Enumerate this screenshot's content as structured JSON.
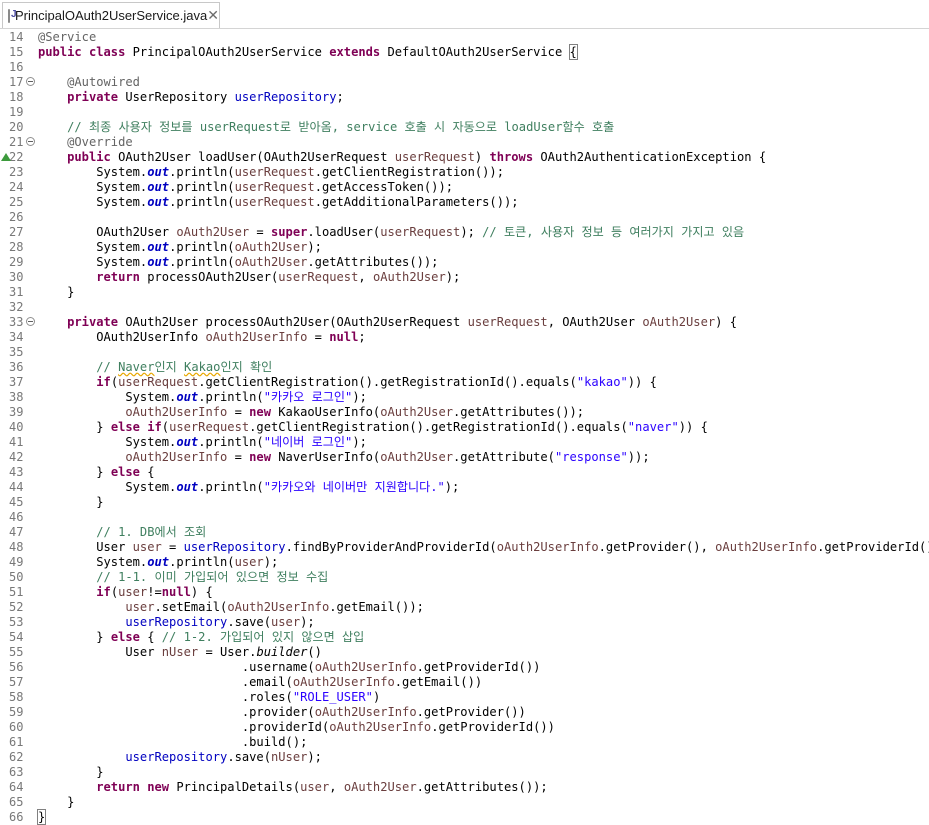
{
  "tab": {
    "filename": "PrincipalOAuth2UserService.java",
    "icon": "java-file-icon",
    "close_label": "✕"
  },
  "editor": {
    "lines": [
      {
        "n": "14",
        "segs": [
          [
            "an",
            "@Service"
          ]
        ]
      },
      {
        "n": "15",
        "segs": [
          [
            "kw",
            "public"
          ],
          [
            "p",
            " "
          ],
          [
            "kw",
            "class"
          ],
          [
            "p",
            " PrincipalOAuth2UserService "
          ],
          [
            "kw",
            "extends"
          ],
          [
            "p",
            " DefaultOAuth2UserService "
          ],
          [
            "brace",
            "{"
          ]
        ]
      },
      {
        "n": "16",
        "segs": []
      },
      {
        "n": "17",
        "fold": true,
        "segs": [
          [
            "p",
            "    "
          ],
          [
            "an",
            "@Autowired"
          ]
        ]
      },
      {
        "n": "18",
        "segs": [
          [
            "p",
            "    "
          ],
          [
            "kw",
            "private"
          ],
          [
            "p",
            " UserRepository "
          ],
          [
            "fd",
            "userRepository"
          ],
          [
            "p",
            ";"
          ]
        ]
      },
      {
        "n": "19",
        "segs": []
      },
      {
        "n": "20",
        "segs": [
          [
            "p",
            "    "
          ],
          [
            "cm",
            "// 최종 사용자 정보를 userRequest로 받아옴, service 호출 시 자동으로 loadUser함수 호출"
          ]
        ]
      },
      {
        "n": "21",
        "fold": true,
        "segs": [
          [
            "p",
            "    "
          ],
          [
            "an",
            "@Override"
          ]
        ]
      },
      {
        "n": "22",
        "override": true,
        "segs": [
          [
            "p",
            "    "
          ],
          [
            "kw",
            "public"
          ],
          [
            "p",
            " OAuth2User loadUser(OAuth2UserRequest "
          ],
          [
            "lv",
            "userRequest"
          ],
          [
            "p",
            ") "
          ],
          [
            "kw",
            "throws"
          ],
          [
            "p",
            " OAuth2AuthenticationException {"
          ]
        ]
      },
      {
        "n": "23",
        "segs": [
          [
            "p",
            "        System."
          ],
          [
            "sf",
            "out"
          ],
          [
            "p",
            ".println("
          ],
          [
            "lv",
            "userRequest"
          ],
          [
            "p",
            ".getClientRegistration());"
          ]
        ]
      },
      {
        "n": "24",
        "segs": [
          [
            "p",
            "        System."
          ],
          [
            "sf",
            "out"
          ],
          [
            "p",
            ".println("
          ],
          [
            "lv",
            "userRequest"
          ],
          [
            "p",
            ".getAccessToken());"
          ]
        ]
      },
      {
        "n": "25",
        "segs": [
          [
            "p",
            "        System."
          ],
          [
            "sf",
            "out"
          ],
          [
            "p",
            ".println("
          ],
          [
            "lv",
            "userRequest"
          ],
          [
            "p",
            ".getAdditionalParameters());"
          ]
        ]
      },
      {
        "n": "26",
        "segs": []
      },
      {
        "n": "27",
        "segs": [
          [
            "p",
            "        OAuth2User "
          ],
          [
            "lv",
            "oAuth2User"
          ],
          [
            "p",
            " = "
          ],
          [
            "kw",
            "super"
          ],
          [
            "p",
            ".loadUser("
          ],
          [
            "lv",
            "userRequest"
          ],
          [
            "p",
            "); "
          ],
          [
            "cm",
            "// 토큰, 사용자 정보 등 여러가지 가지고 있음"
          ]
        ]
      },
      {
        "n": "28",
        "segs": [
          [
            "p",
            "        System."
          ],
          [
            "sf",
            "out"
          ],
          [
            "p",
            ".println("
          ],
          [
            "lv",
            "oAuth2User"
          ],
          [
            "p",
            ");"
          ]
        ]
      },
      {
        "n": "29",
        "segs": [
          [
            "p",
            "        System."
          ],
          [
            "sf",
            "out"
          ],
          [
            "p",
            ".println("
          ],
          [
            "lv",
            "oAuth2User"
          ],
          [
            "p",
            ".getAttributes());"
          ]
        ]
      },
      {
        "n": "30",
        "segs": [
          [
            "p",
            "        "
          ],
          [
            "kw",
            "return"
          ],
          [
            "p",
            " processOAuth2User("
          ],
          [
            "lv",
            "userRequest"
          ],
          [
            "p",
            ", "
          ],
          [
            "lv",
            "oAuth2User"
          ],
          [
            "p",
            ");"
          ]
        ]
      },
      {
        "n": "31",
        "segs": [
          [
            "p",
            "    }"
          ]
        ]
      },
      {
        "n": "32",
        "segs": []
      },
      {
        "n": "33",
        "fold": true,
        "segs": [
          [
            "p",
            "    "
          ],
          [
            "kw",
            "private"
          ],
          [
            "p",
            " OAuth2User processOAuth2User(OAuth2UserRequest "
          ],
          [
            "lv",
            "userRequest"
          ],
          [
            "p",
            ", OAuth2User "
          ],
          [
            "lv",
            "oAuth2User"
          ],
          [
            "p",
            ") {"
          ]
        ]
      },
      {
        "n": "34",
        "segs": [
          [
            "p",
            "        OAuth2UserInfo "
          ],
          [
            "lv",
            "oAuth2UserInfo"
          ],
          [
            "p",
            " = "
          ],
          [
            "kw",
            "null"
          ],
          [
            "p",
            ";"
          ]
        ]
      },
      {
        "n": "35",
        "segs": []
      },
      {
        "n": "36",
        "segs": [
          [
            "p",
            "        "
          ],
          [
            "cm",
            "// "
          ],
          [
            "cmsq",
            "Naver"
          ],
          [
            "cm",
            "인지 "
          ],
          [
            "cmsq",
            "Kakao"
          ],
          [
            "cm",
            "인지 확인"
          ]
        ]
      },
      {
        "n": "37",
        "segs": [
          [
            "p",
            "        "
          ],
          [
            "kw",
            "if"
          ],
          [
            "p",
            "("
          ],
          [
            "lv",
            "userRequest"
          ],
          [
            "p",
            ".getClientRegistration().getRegistrationId().equals("
          ],
          [
            "st",
            "\"kakao\""
          ],
          [
            "p",
            ")) {"
          ]
        ]
      },
      {
        "n": "38",
        "segs": [
          [
            "p",
            "            System."
          ],
          [
            "sf",
            "out"
          ],
          [
            "p",
            ".println("
          ],
          [
            "st",
            "\"카카오 로그인\""
          ],
          [
            "p",
            ");"
          ]
        ]
      },
      {
        "n": "39",
        "segs": [
          [
            "p",
            "            "
          ],
          [
            "lv",
            "oAuth2UserInfo"
          ],
          [
            "p",
            " = "
          ],
          [
            "kw",
            "new"
          ],
          [
            "p",
            " KakaoUserInfo("
          ],
          [
            "lv",
            "oAuth2User"
          ],
          [
            "p",
            ".getAttributes());"
          ]
        ]
      },
      {
        "n": "40",
        "segs": [
          [
            "p",
            "        } "
          ],
          [
            "kw",
            "else"
          ],
          [
            "p",
            " "
          ],
          [
            "kw",
            "if"
          ],
          [
            "p",
            "("
          ],
          [
            "lv",
            "userRequest"
          ],
          [
            "p",
            ".getClientRegistration().getRegistrationId().equals("
          ],
          [
            "st",
            "\"naver\""
          ],
          [
            "p",
            ")) {"
          ]
        ]
      },
      {
        "n": "41",
        "segs": [
          [
            "p",
            "            System."
          ],
          [
            "sf",
            "out"
          ],
          [
            "p",
            ".println("
          ],
          [
            "st",
            "\"네이버 로그인\""
          ],
          [
            "p",
            ");"
          ]
        ]
      },
      {
        "n": "42",
        "segs": [
          [
            "p",
            "            "
          ],
          [
            "lv",
            "oAuth2UserInfo"
          ],
          [
            "p",
            " = "
          ],
          [
            "kw",
            "new"
          ],
          [
            "p",
            " NaverUserInfo("
          ],
          [
            "lv",
            "oAuth2User"
          ],
          [
            "p",
            ".getAttribute("
          ],
          [
            "st",
            "\"response\""
          ],
          [
            "p",
            "));"
          ]
        ]
      },
      {
        "n": "43",
        "segs": [
          [
            "p",
            "        } "
          ],
          [
            "kw",
            "else"
          ],
          [
            "p",
            " {"
          ]
        ]
      },
      {
        "n": "44",
        "segs": [
          [
            "p",
            "            System."
          ],
          [
            "sf",
            "out"
          ],
          [
            "p",
            ".println("
          ],
          [
            "st",
            "\"카카오와 네이버만 지원합니다.\""
          ],
          [
            "p",
            ");"
          ]
        ]
      },
      {
        "n": "45",
        "segs": [
          [
            "p",
            "        }"
          ]
        ]
      },
      {
        "n": "46",
        "segs": []
      },
      {
        "n": "47",
        "segs": [
          [
            "p",
            "        "
          ],
          [
            "cm",
            "// 1. DB에서 조회"
          ]
        ]
      },
      {
        "n": "48",
        "segs": [
          [
            "p",
            "        User "
          ],
          [
            "lv",
            "user"
          ],
          [
            "p",
            " = "
          ],
          [
            "fd",
            "userRepository"
          ],
          [
            "p",
            ".findByProviderAndProviderId("
          ],
          [
            "lv",
            "oAuth2UserInfo"
          ],
          [
            "p",
            ".getProvider(), "
          ],
          [
            "lv",
            "oAuth2UserInfo"
          ],
          [
            "p",
            ".getProviderId());"
          ]
        ]
      },
      {
        "n": "49",
        "segs": [
          [
            "p",
            "        System."
          ],
          [
            "sf",
            "out"
          ],
          [
            "p",
            ".println("
          ],
          [
            "lv",
            "user"
          ],
          [
            "p",
            ");"
          ]
        ]
      },
      {
        "n": "50",
        "segs": [
          [
            "p",
            "        "
          ],
          [
            "cm",
            "// 1-1. 이미 가입되어 있으면 정보 수집"
          ]
        ]
      },
      {
        "n": "51",
        "segs": [
          [
            "p",
            "        "
          ],
          [
            "kw",
            "if"
          ],
          [
            "p",
            "("
          ],
          [
            "lv",
            "user"
          ],
          [
            "p",
            "!="
          ],
          [
            "kw",
            "null"
          ],
          [
            "p",
            ") {"
          ]
        ]
      },
      {
        "n": "52",
        "segs": [
          [
            "p",
            "            "
          ],
          [
            "lv",
            "user"
          ],
          [
            "p",
            ".setEmail("
          ],
          [
            "lv",
            "oAuth2UserInfo"
          ],
          [
            "p",
            ".getEmail());"
          ]
        ]
      },
      {
        "n": "53",
        "segs": [
          [
            "p",
            "            "
          ],
          [
            "fd",
            "userRepository"
          ],
          [
            "p",
            ".save("
          ],
          [
            "lv",
            "user"
          ],
          [
            "p",
            ");"
          ]
        ]
      },
      {
        "n": "54",
        "segs": [
          [
            "p",
            "        } "
          ],
          [
            "kw",
            "else"
          ],
          [
            "p",
            " { "
          ],
          [
            "cm",
            "// 1-2. 가입되어 있지 않으면 삽입"
          ]
        ]
      },
      {
        "n": "55",
        "segs": [
          [
            "p",
            "            User "
          ],
          [
            "lv",
            "nUser"
          ],
          [
            "p",
            " = User."
          ],
          [
            "it",
            "builder"
          ],
          [
            "p",
            "()"
          ]
        ]
      },
      {
        "n": "56",
        "segs": [
          [
            "p",
            "                            .username("
          ],
          [
            "lv",
            "oAuth2UserInfo"
          ],
          [
            "p",
            ".getProviderId())"
          ]
        ]
      },
      {
        "n": "57",
        "segs": [
          [
            "p",
            "                            .email("
          ],
          [
            "lv",
            "oAuth2UserInfo"
          ],
          [
            "p",
            ".getEmail())"
          ]
        ]
      },
      {
        "n": "58",
        "segs": [
          [
            "p",
            "                            .roles("
          ],
          [
            "st",
            "\"ROLE_USER\""
          ],
          [
            "p",
            ")"
          ]
        ]
      },
      {
        "n": "59",
        "segs": [
          [
            "p",
            "                            .provider("
          ],
          [
            "lv",
            "oAuth2UserInfo"
          ],
          [
            "p",
            ".getProvider())"
          ]
        ]
      },
      {
        "n": "60",
        "segs": [
          [
            "p",
            "                            .providerId("
          ],
          [
            "lv",
            "oAuth2UserInfo"
          ],
          [
            "p",
            ".getProviderId())"
          ]
        ]
      },
      {
        "n": "61",
        "segs": [
          [
            "p",
            "                            .build();"
          ]
        ]
      },
      {
        "n": "62",
        "segs": [
          [
            "p",
            "            "
          ],
          [
            "fd",
            "userRepository"
          ],
          [
            "p",
            ".save("
          ],
          [
            "lv",
            "nUser"
          ],
          [
            "p",
            ");"
          ]
        ]
      },
      {
        "n": "63",
        "segs": [
          [
            "p",
            "        }"
          ]
        ]
      },
      {
        "n": "64",
        "segs": [
          [
            "p",
            "        "
          ],
          [
            "kw",
            "return"
          ],
          [
            "p",
            " "
          ],
          [
            "kw",
            "new"
          ],
          [
            "p",
            " PrincipalDetails("
          ],
          [
            "lv",
            "user"
          ],
          [
            "p",
            ", "
          ],
          [
            "lv",
            "oAuth2User"
          ],
          [
            "p",
            ".getAttributes());"
          ]
        ]
      },
      {
        "n": "65",
        "segs": [
          [
            "p",
            "    }"
          ]
        ]
      },
      {
        "n": "66",
        "segs": [
          [
            "brace",
            "}"
          ]
        ]
      }
    ]
  }
}
